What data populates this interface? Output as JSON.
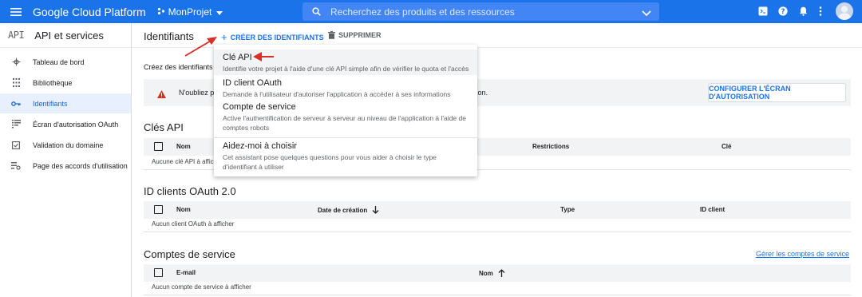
{
  "topbar": {
    "app_title": "Google Cloud Platform",
    "project_name": "MonProjet",
    "search_placeholder": "Recherchez des produits et des ressources",
    "icons": [
      "menu-icon",
      "project-icon",
      "chevron-down-icon",
      "search-icon",
      "terminal-icon",
      "help-icon",
      "bell-icon",
      "more-vert-icon",
      "avatar"
    ]
  },
  "sidebar": {
    "title": "API et services",
    "logo": "API",
    "items": [
      {
        "label": "Tableau de bord",
        "icon": "dashboard-icon"
      },
      {
        "label": "Bibliothèque",
        "icon": "library-icon"
      },
      {
        "label": "Identifiants",
        "icon": "key-icon",
        "active": true
      },
      {
        "label": "Écran d'autorisation OAuth",
        "icon": "consent-icon"
      },
      {
        "label": "Validation du domaine",
        "icon": "checkbox-icon"
      },
      {
        "label": "Page des accords d'utilisation",
        "icon": "settings-list-icon"
      }
    ]
  },
  "header": {
    "title": "Identifiants",
    "create_label": "CRÉER DES IDENTIFIANTS",
    "delete_label": "SUPPRIMER"
  },
  "main": {
    "intro": "Créez des identifiants po",
    "warning_start": "N'oubliez pa",
    "warning_end": "ation.",
    "config_button": "CONFIGURER L'ÉCRAN D'AUTORISATION",
    "api_keys": {
      "title": "Clés API",
      "columns": [
        "Nom",
        "Restrictions",
        "Clé"
      ],
      "empty": "Aucune clé API à affich"
    },
    "oauth": {
      "title": "ID clients OAuth 2.0",
      "columns": [
        "Nom",
        "Date de création",
        "Type",
        "ID client"
      ],
      "empty": "Aucun client OAuth à afficher"
    },
    "service_accounts": {
      "title": "Comptes de service",
      "manage_link": "Gérer les comptes de service",
      "columns": [
        "E-mail",
        "Nom"
      ],
      "empty": "Aucun compte de service à afficher"
    }
  },
  "dropdown": {
    "items": [
      {
        "title": "Clé API",
        "desc": "Identifie votre projet à l'aide d'une clé API simple afin de vérifier le quota et l'accès"
      },
      {
        "title": "ID client OAuth",
        "desc": "Demande à l'utilisateur d'autoriser l'application à accéder à ses informations"
      },
      {
        "title": "Compte de service",
        "desc": "Active l'authentification de serveur à serveur au niveau de l'application à l'aide de comptes robots"
      },
      {
        "title": "Aidez-moi à choisir",
        "desc": "Cet assistant pose quelques questions pour vous aider à choisir le type d'identifiant à utiliser"
      }
    ]
  },
  "colors": {
    "brand_blue": "#1a73e8",
    "annotation_red": "#d93025",
    "warning_red": "#d93025"
  }
}
